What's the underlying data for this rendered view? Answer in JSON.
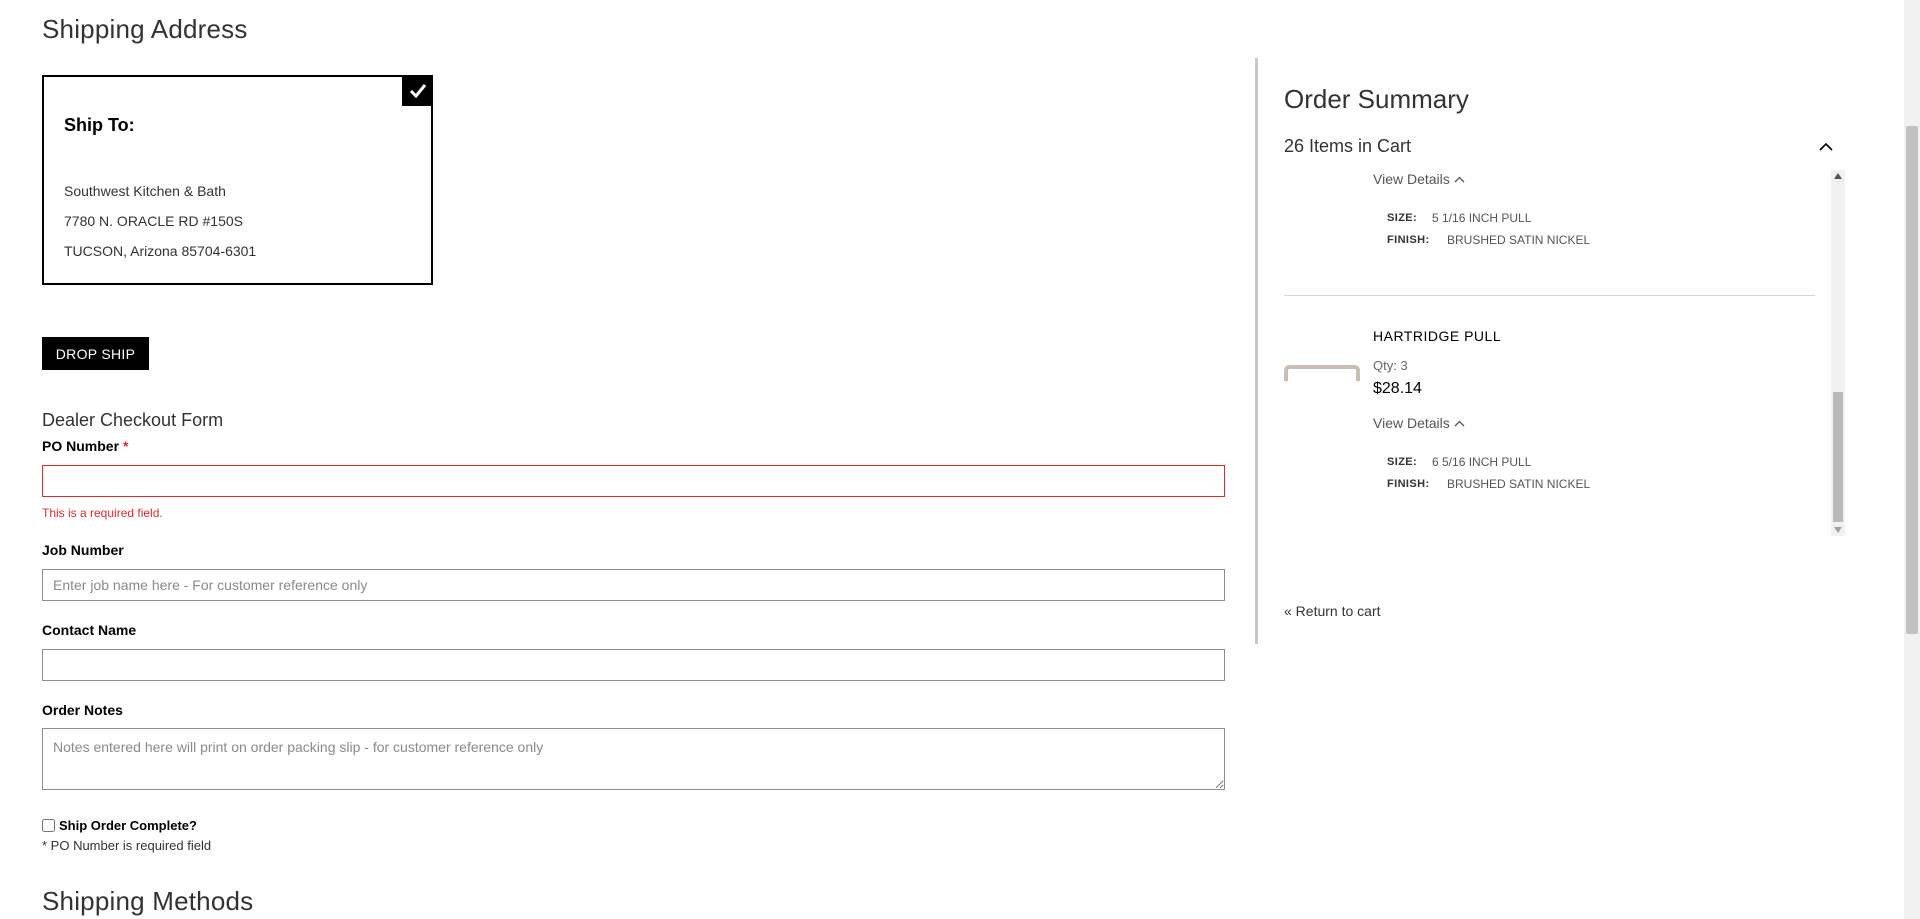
{
  "shipping_address": {
    "title": "Shipping Address",
    "card": {
      "heading": "Ship To:",
      "lines": [
        "Southwest Kitchen & Bath",
        "7780 N. ORACLE RD #150S",
        "TUCSON, Arizona 85704-6301"
      ],
      "selected": true
    },
    "drop_ship_label": "DROP SHIP"
  },
  "dealer_form": {
    "title": "Dealer Checkout Form",
    "po_number": {
      "label": "PO Number",
      "required_mark": "*",
      "value": "",
      "placeholder": "",
      "error": "This is a required field."
    },
    "job_number": {
      "label": "Job Number",
      "value": "",
      "placeholder": "Enter job name here - For customer reference only"
    },
    "contact_name": {
      "label": "Contact Name",
      "value": "",
      "placeholder": ""
    },
    "order_notes": {
      "label": "Order Notes",
      "value": "",
      "placeholder": "Notes entered here will print on order packing slip - for customer reference only"
    },
    "ship_complete": {
      "label": "Ship Order Complete?",
      "checked": false
    },
    "note": "* PO Number is required field"
  },
  "shipping_methods": {
    "title": "Shipping Methods"
  },
  "order_summary": {
    "title": "Order Summary",
    "cart_count": "26 Items in Cart",
    "items": [
      {
        "view_details": "View Details",
        "attributes": [
          {
            "key": "SIZE:",
            "value": "5 1/16 INCH PULL"
          },
          {
            "key": "FINISH:",
            "value": "BRUSHED SATIN NICKEL"
          }
        ]
      },
      {
        "name": "HARTRIDGE PULL",
        "qty": "Qty: 3",
        "price": "$28.14",
        "view_details": "View Details",
        "attributes": [
          {
            "key": "SIZE:",
            "value": "6 5/16 INCH PULL"
          },
          {
            "key": "FINISH:",
            "value": "BRUSHED SATIN NICKEL"
          }
        ]
      }
    ],
    "return_link": "« Return to cart"
  },
  "colors": {
    "error": "#e02b27",
    "primary": "#000000",
    "divider": "#c8c8c8",
    "pull_finish": "#c9beb2"
  },
  "icons": {
    "card_check": "checkmark-icon",
    "collapse": "chevron-up-icon"
  }
}
